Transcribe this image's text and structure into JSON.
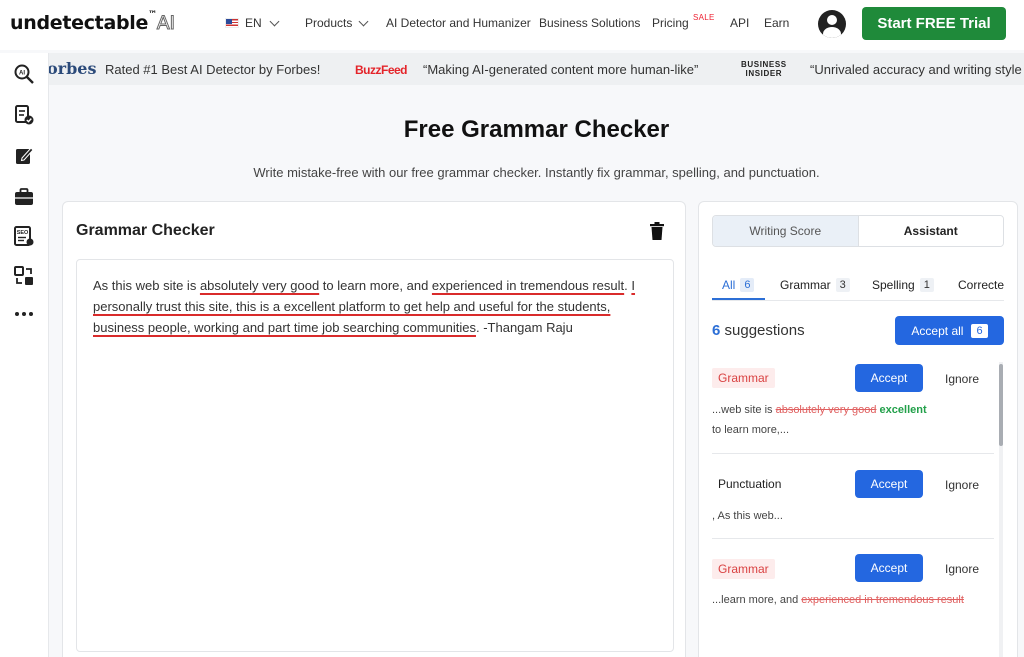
{
  "brand": {
    "name": "undetectable",
    "tm": "™",
    "ai": "AI"
  },
  "nav": {
    "lang": "EN",
    "products": "Products",
    "detector": "AI Detector and Humanizer",
    "business": "Business Solutions",
    "pricing": "Pricing",
    "sale": "SALE",
    "api": "API",
    "earn": "Earn",
    "cta": "Start FREE Trial"
  },
  "press": {
    "forbes_logo": "orbes",
    "forbes_quote": "Rated #1 Best AI Detector by Forbes!",
    "buzzfeed_logo": "BuzzFeed",
    "buzzfeed_quote": "“Making AI-generated content more human-like”",
    "bi_logo_1": "BUSINESS",
    "bi_logo_2": "INSIDER",
    "bi_quote": "“Unrivaled accuracy and writing style"
  },
  "sidebar": {
    "icons": [
      "ai-search-icon",
      "document-check-icon",
      "edit-icon",
      "briefcase-icon",
      "seo-report-icon",
      "transform-icon",
      "more-icon"
    ]
  },
  "page": {
    "title": "Free Grammar Checker",
    "subtitle": "Write mistake-free with our free grammar checker. Instantly fix grammar, spelling, and punctuation."
  },
  "checker": {
    "title": "Grammar Checker",
    "text": {
      "t1": "As this web site is ",
      "e1": "absolutely very good",
      "t2": " to learn more, and ",
      "e2": "experienced in tremendous result",
      "t3": ". ",
      "e3": "I",
      "t4": " ",
      "e4": "personally trust this site, this is a excellent platform to get help and useful for the students, business people, working and part time job searching communities",
      "t5": ". -Thangam Raju"
    }
  },
  "panel": {
    "seg_score": "Writing Score",
    "seg_assistant": "Assistant",
    "tabs": [
      {
        "label": "All",
        "count": "6"
      },
      {
        "label": "Grammar",
        "count": "3"
      },
      {
        "label": "Spelling",
        "count": "1"
      },
      {
        "label": "Correcte",
        "count": ""
      }
    ],
    "suggestions_count": "6",
    "suggestions_label": "suggestions",
    "accept_all": "Accept all",
    "accept_all_count": "6",
    "items": [
      {
        "tag": "Grammar",
        "accept": "Accept",
        "ignore": "Ignore",
        "pre": "...web site is ",
        "strike": "absolutely very good",
        "fix": " excellent",
        "post": "to learn more,..."
      },
      {
        "tag": "Punctuation",
        "accept": "Accept",
        "ignore": "Ignore",
        "pre": ", As this web...",
        "strike": "",
        "fix": "",
        "post": ""
      },
      {
        "tag": "Grammar",
        "accept": "Accept",
        "ignore": "Ignore",
        "pre": "...learn more, and ",
        "strike": "experienced in tremendous result",
        "fix": "",
        "post": ""
      }
    ]
  }
}
